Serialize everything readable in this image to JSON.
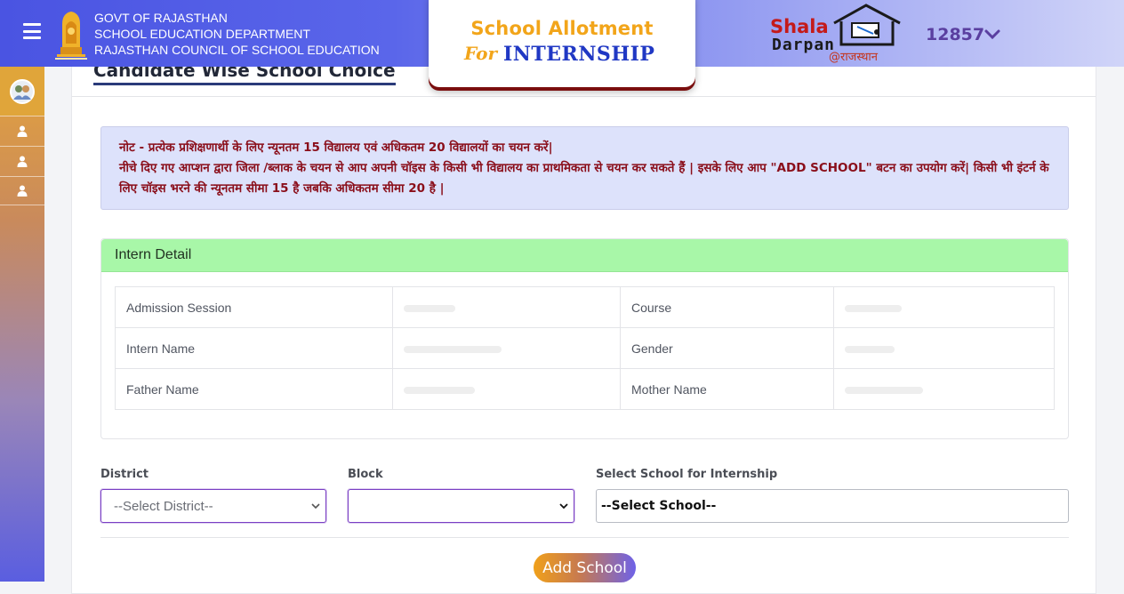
{
  "header": {
    "gov_lines": [
      "GOVT OF RAJASTHAN",
      "SCHOOL EDUCATION DEPARTMENT",
      "RAJASTHAN COUNCIL OF SCHOOL EDUCATION"
    ],
    "app_title_line1": "School Allotment",
    "app_title_for": "For",
    "app_title_line2": "INTERNSHIP",
    "logo_shala": "Shala",
    "logo_darpan": "Darpan",
    "logo_rajasthan": "@राजस्थान",
    "user_id": "12857"
  },
  "sidebar": {
    "items": [
      {
        "icon": "user-icon"
      },
      {
        "icon": "user-icon"
      },
      {
        "icon": "user-icon"
      }
    ]
  },
  "page": {
    "title": "Candidate Wise School Choice",
    "note_line1": "नोट - प्रत्येक प्रशिक्षणार्थी के लिए न्यूनतम 15 विद्यालय एवं अधिकतम 20 विद्यालयों का चयन करें|",
    "note_line2": "नीचे दिए गए आप्शन द्वारा जिला /ब्लाक के चयन से आप अपनी चॉइस के किसी भी विद्यालय का प्राथमिकता से चयन कर सकते हैं | इसके लिए आप \"ADD SCHOOL\" बटन का उपयोग करें| किसी भी इंटर्न के लिए चॉइस भरने की न्यूनतम सीमा 15 है जबकि अधिकतम सीमा 20 है |"
  },
  "intern_detail": {
    "heading": "Intern Detail",
    "rows": [
      {
        "label1": "Admission Session",
        "label2": "Course"
      },
      {
        "label1": "Intern Name",
        "label2": "Gender"
      },
      {
        "label1": "Father Name",
        "label2": "Mother Name"
      }
    ]
  },
  "form": {
    "district_label": "District",
    "district_value": "--Select District--",
    "block_label": "Block",
    "block_value": "",
    "school_label": "Select School for Internship",
    "school_value": "--Select School--",
    "add_button": "Add School"
  },
  "colors": {
    "header_gradient_start": "#4a54e2",
    "accent_orange": "#f2a51a",
    "internship_blue": "#2038c4",
    "note_text": "#8a0e1a",
    "intern_head_bg": "#a8f7a8",
    "user_id_color": "#5a3fa0"
  }
}
